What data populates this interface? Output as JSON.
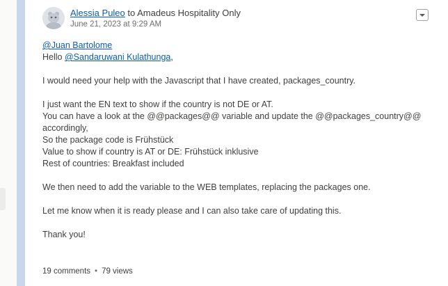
{
  "post": {
    "author": "Alessia Puleo",
    "header_connector": " to ",
    "group": "Amadeus Hospitality Only",
    "timestamp": "June 21, 2023 at 9:29 AM",
    "menu_icon": "chevron-down-icon",
    "avatar_icon": "astro-avatar-icon",
    "body": {
      "mention_juan": "@Juan Bartolome",
      "hello_prefix": "Hello ",
      "mention_sandaruwani": "@Sandaruwani Kulathunga",
      "hello_suffix": ",",
      "line_help": "I would need your help with the Javascript that I have created, packages_country.",
      "line_en": "I just want the EN text to show if the country is not DE or AT.",
      "line_look_1": "You can have a look at the @@packages@@ variable and update the @@packages_country@@",
      "line_look_2": "accordingly,",
      "line_code": "So the package code is Frühstück",
      "line_value": "Value to show if country is AT or DE: Frühstück inklusive",
      "line_rest": "Rest of countries: Breakfast included",
      "line_web": "We then need to add the variable to the WEB templates, replacing the packages one.",
      "line_ready": "Let me know when it is ready please and I can also take care of updating this.",
      "line_thanks": "Thank you!"
    },
    "footer": {
      "comments": "19 comments",
      "separator": "•",
      "views": "79 views"
    }
  },
  "colors": {
    "link": "#0b5cab",
    "rail": "#c9d7ea",
    "text": "#3e3e3c",
    "muted": "#706e6b"
  }
}
